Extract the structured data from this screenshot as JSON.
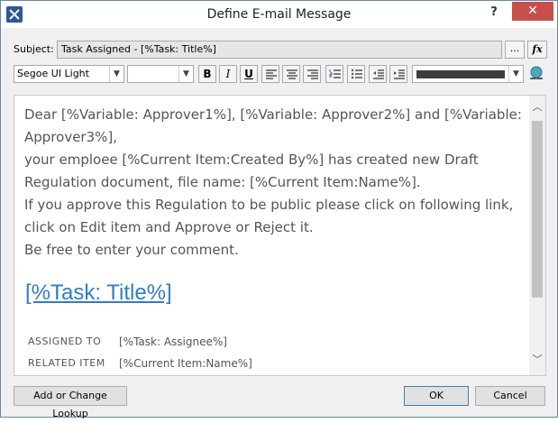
{
  "window": {
    "title": "Define E-mail Message",
    "help_label": "?",
    "close_label": "✕"
  },
  "subject": {
    "label": "Subject:",
    "value": "Task Assigned - [%Task: Title%]",
    "ellipsis_label": "...",
    "fx_label": "fx"
  },
  "toolbar": {
    "font": "Segoe UI Light",
    "size": "",
    "bold_label": "B",
    "italic_label": "I",
    "underline_label": "U",
    "text_color": "#3d3d3d"
  },
  "editor": {
    "lines": [
      "Dear [%Variable: Approver1%], [%Variable: Approver2%] and [%Variable: Approver3%],",
      "your emploee [%Current Item:Created By%] has created new Draft Regulation document, file name: [%Current Item:Name%].",
      "If you approve this Regulation to be public please click on following link, click on Edit item and Approve or Reject it.",
      "Be free to enter your comment."
    ],
    "link_text": "[%Task: Title%]",
    "meta": [
      {
        "key": "ASSIGNED TO",
        "value": "[%Task: Assignee%]"
      },
      {
        "key": "RELATED ITEM",
        "value": "[%Current Item:Name%]"
      }
    ]
  },
  "buttons": {
    "lookup": "Add or Change Lookup",
    "ok": "OK",
    "cancel": "Cancel"
  }
}
